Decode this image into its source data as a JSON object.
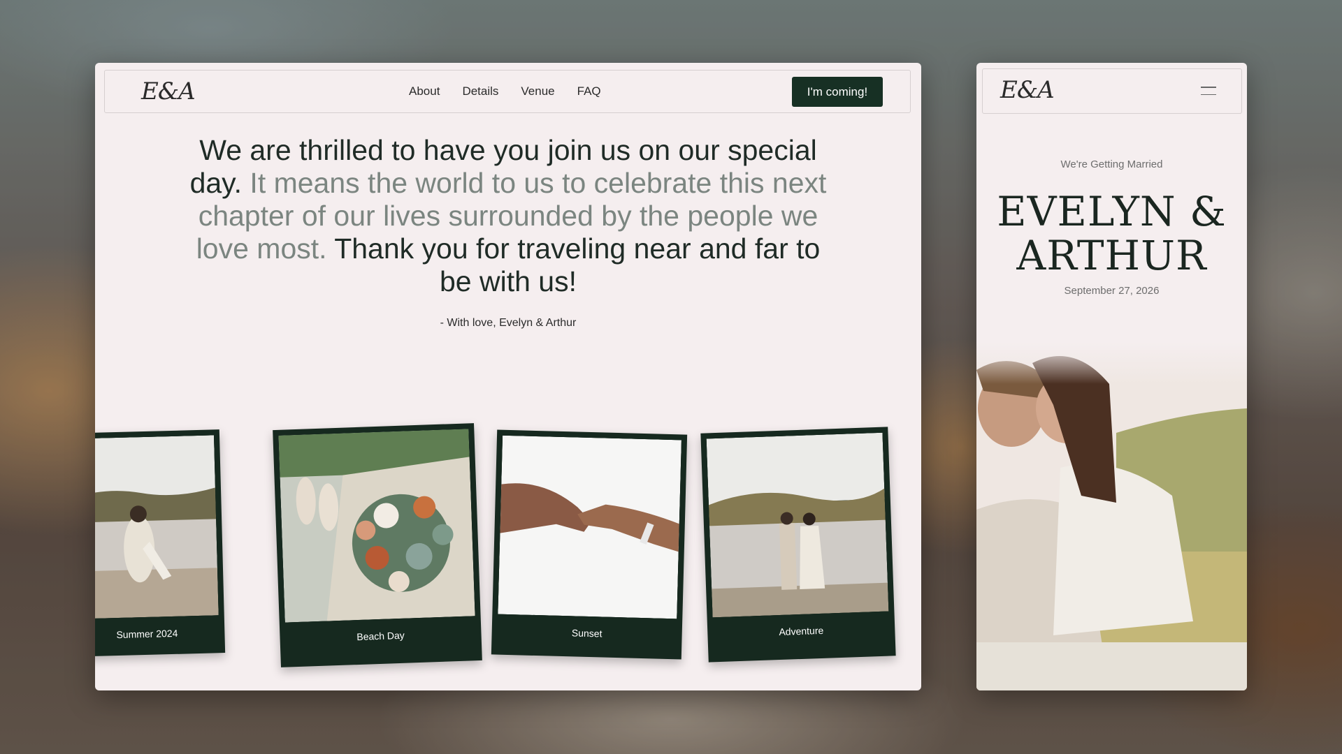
{
  "desktop": {
    "logo": "E&A",
    "nav_links": [
      "About",
      "Details",
      "Venue",
      "FAQ"
    ],
    "cta_label": "I'm coming!",
    "intro": {
      "part1": "We are thrilled to have you join us on our special day.",
      "part2": "It means the world to us to celebrate this next chapter of our lives surrounded by the people we love most.",
      "part3": "Thank you for traveling near and far to be with us!"
    },
    "signoff": "- With love, Evelyn & Arthur",
    "gallery": [
      {
        "caption": "Summer 2024",
        "photo": "couple-hug-by-lake"
      },
      {
        "caption": "Beach Day",
        "photo": "bouquet-and-shoes"
      },
      {
        "caption": "Sunset",
        "photo": "holding-hands"
      },
      {
        "caption": "Adventure",
        "photo": "couple-at-lake"
      }
    ]
  },
  "mobile": {
    "logo": "E&A",
    "menu_icon": "hamburger-icon",
    "eyebrow": "We're Getting Married",
    "names_line1": "EVELYN &",
    "names_line2": "ARTHUR",
    "date": "September 27, 2026",
    "hero_photo": "couple-picnic-in-field"
  },
  "colors": {
    "accent_dark_green": "#173024",
    "page_bg": "#f5eeef",
    "text_dark": "#1f2b26",
    "text_muted": "#7b8580"
  }
}
